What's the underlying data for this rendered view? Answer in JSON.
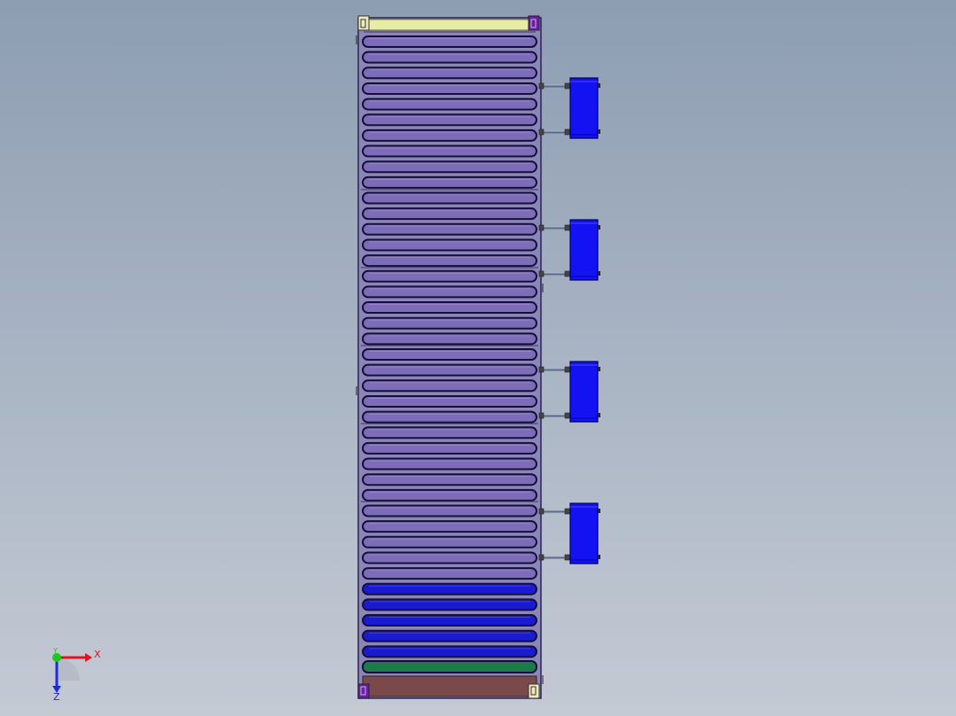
{
  "viewport": {
    "background_top": "#8d9db2",
    "background_bottom": "#c4cad4"
  },
  "model": {
    "panel_frame_color": "#2a2550",
    "top_bar_color": "#e6eda2",
    "corner_block_color": "#efe9bf",
    "corner_block_dark_color": "#6b1fa6",
    "tube_color": "#7d6cb8",
    "tube_outline_color": "#15103a",
    "tube_count": 40,
    "blue_tube_count": 5,
    "blue_tube_color": "#1a1ad0",
    "green_tube_color": "#1f7a4a",
    "bottom_block_color": "#7a4a4a",
    "manifold_color": "#1212f2",
    "manifold_count": 4,
    "pipe_color": "#5a6a8a"
  },
  "triad": {
    "x_label": "X",
    "y_label": "Y",
    "z_label": "Z",
    "x_color": "#e0141e",
    "y_color": "#1ec81e",
    "z_color": "#1e2ae0"
  }
}
